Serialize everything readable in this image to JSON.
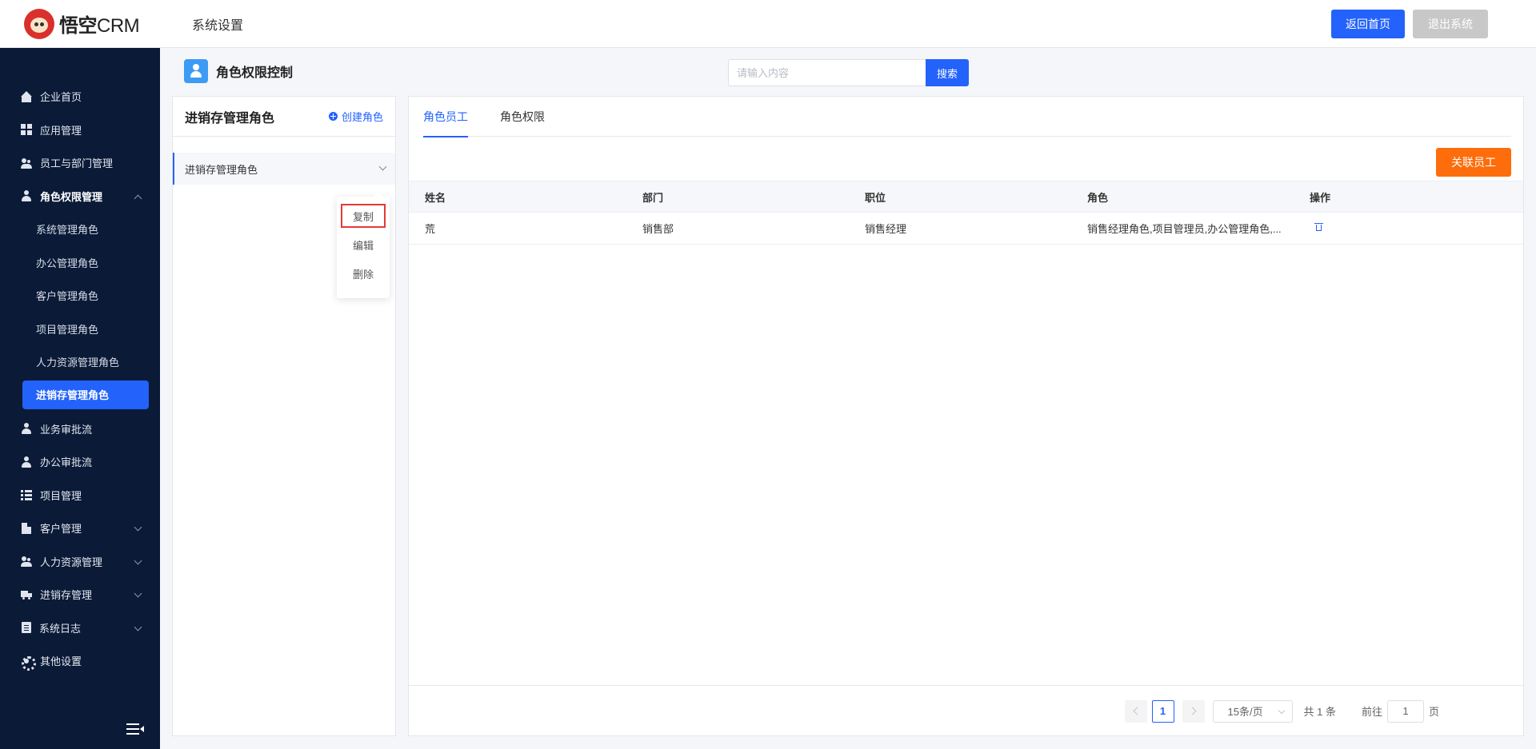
{
  "header": {
    "logo_bold": "悟空",
    "logo_light": "CRM",
    "title": "系统设置",
    "home_button": "返回首页",
    "logout_button": "退出系统"
  },
  "sidebar": {
    "items": [
      {
        "label": "企业首页",
        "icon": "home-icon"
      },
      {
        "label": "应用管理",
        "icon": "grid-icon"
      },
      {
        "label": "员工与部门管理",
        "icon": "users-icon"
      },
      {
        "label": "角色权限管理",
        "icon": "user-icon"
      }
    ],
    "sub_items": [
      "系统管理角色",
      "办公管理角色",
      "客户管理角色",
      "项目管理角色",
      "人力资源管理角色",
      "进销存管理角色"
    ],
    "items_after": [
      {
        "label": "业务审批流",
        "icon": "user-icon"
      },
      {
        "label": "办公审批流",
        "icon": "user-icon"
      },
      {
        "label": "项目管理",
        "icon": "list-icon"
      },
      {
        "label": "客户管理",
        "icon": "building-icon"
      },
      {
        "label": "人力资源管理",
        "icon": "users-icon"
      },
      {
        "label": "进销存管理",
        "icon": "truck-icon"
      },
      {
        "label": "系统日志",
        "icon": "doc-icon"
      },
      {
        "label": "其他设置",
        "icon": "gear-icon"
      }
    ]
  },
  "page": {
    "title": "角色权限控制",
    "search_placeholder": "请输入内容",
    "search_button": "搜索"
  },
  "left_panel": {
    "title": "进销存管理角色",
    "create_label": "创建角色",
    "role_item": "进销存管理角色",
    "menu": [
      "复制",
      "编辑",
      "删除"
    ]
  },
  "right_panel": {
    "tabs": [
      "角色员工",
      "角色权限"
    ],
    "link_button": "关联员工",
    "columns": [
      "姓名",
      "部门",
      "职位",
      "角色",
      "操作"
    ],
    "rows": [
      {
        "name": "荒",
        "dept": "销售部",
        "position": "销售经理",
        "roles": "销售经理角色,项目管理员,办公管理角色,..."
      }
    ],
    "pager": {
      "current": "1",
      "page_size": "15条/页",
      "total": "共 1 条",
      "goto_label": "前往",
      "goto_value": "1",
      "page_unit": "页"
    }
  },
  "colors": {
    "primary": "#2362fb",
    "sidebar_bg": "#0a1a37",
    "orange": "#fd6d0b",
    "highlight_border": "#e53935"
  }
}
